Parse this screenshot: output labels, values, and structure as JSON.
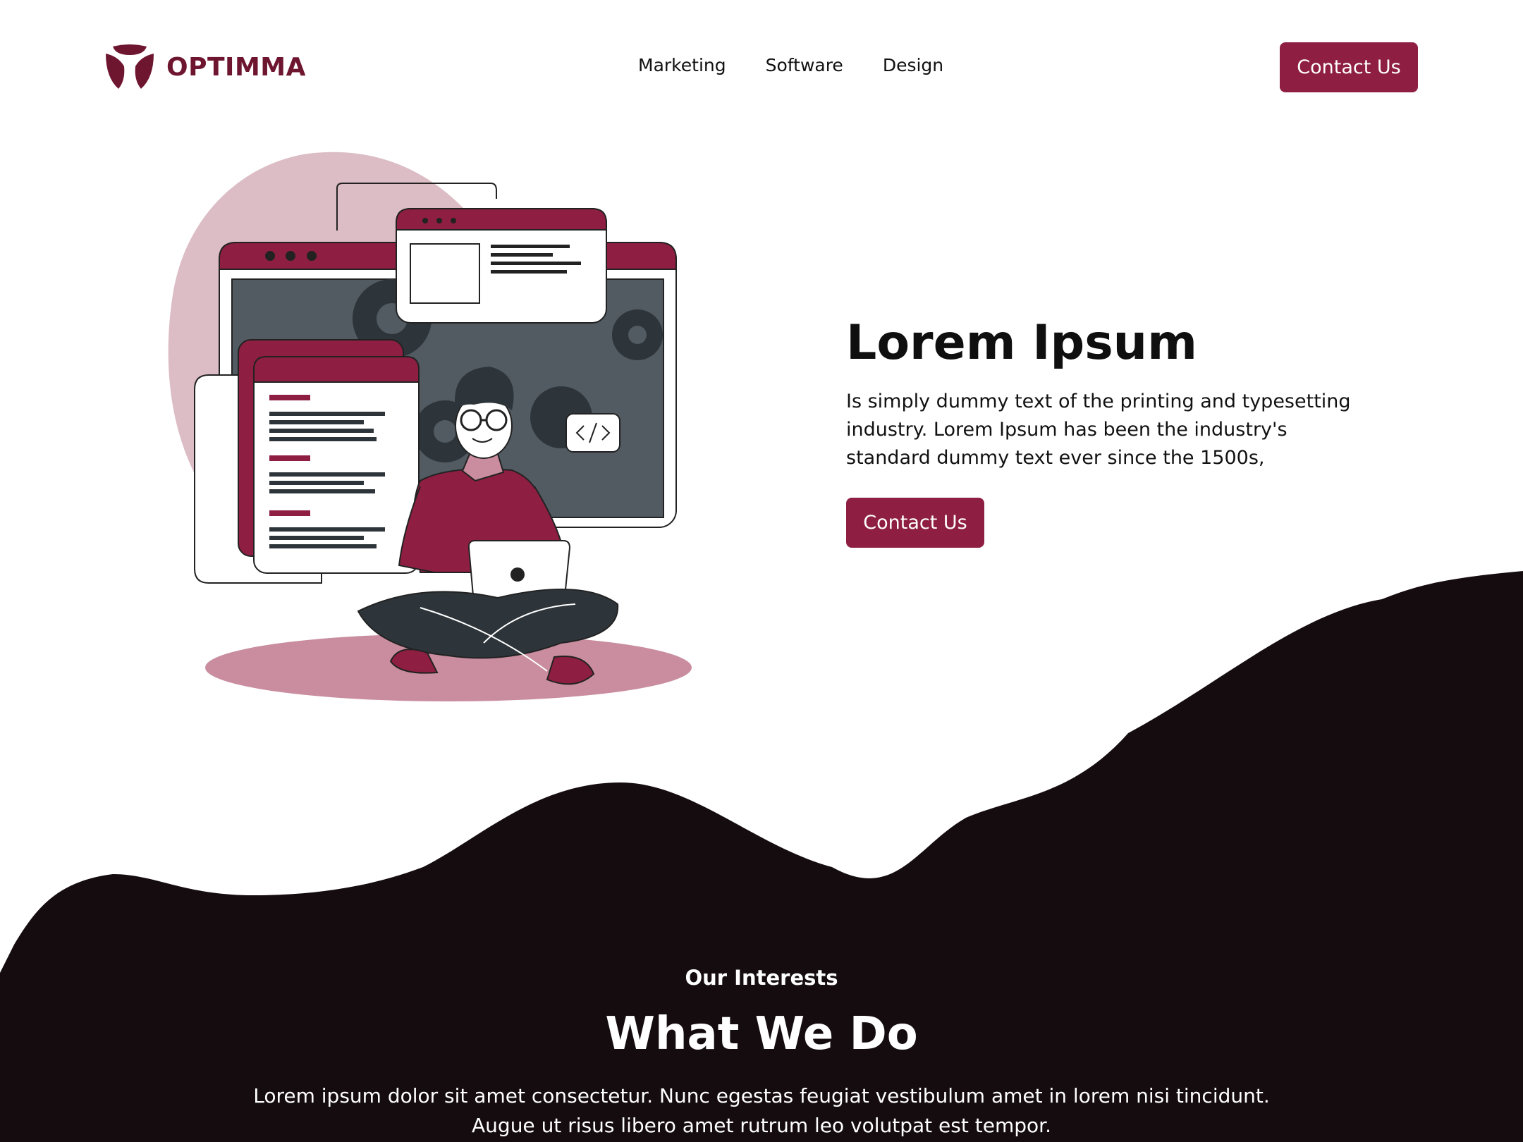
{
  "brand": {
    "name": "OPTIMMA",
    "accent": "#8e1f42",
    "logo_color": "#6e1630",
    "dark_bg": "#150c10"
  },
  "nav": {
    "items": [
      "Marketing",
      "Software",
      "Design"
    ]
  },
  "header": {
    "cta_label": "Contact Us"
  },
  "hero": {
    "title": "Lorem Ipsum",
    "description": "Is simply dummy text of the printing and typesetting industry. Lorem Ipsum has been the industry's standard dummy text ever since the 1500s,",
    "cta_label": "Contact Us",
    "illustration": "developer-with-laptop-illustration"
  },
  "interests": {
    "eyebrow": "Our Interests",
    "title": "What We Do",
    "description": "Lorem ipsum dolor sit amet consectetur. Nunc egestas feugiat vestibulum amet in lorem nisi tincidunt. Augue ut risus libero amet rutrum leo volutpat est tempor."
  }
}
